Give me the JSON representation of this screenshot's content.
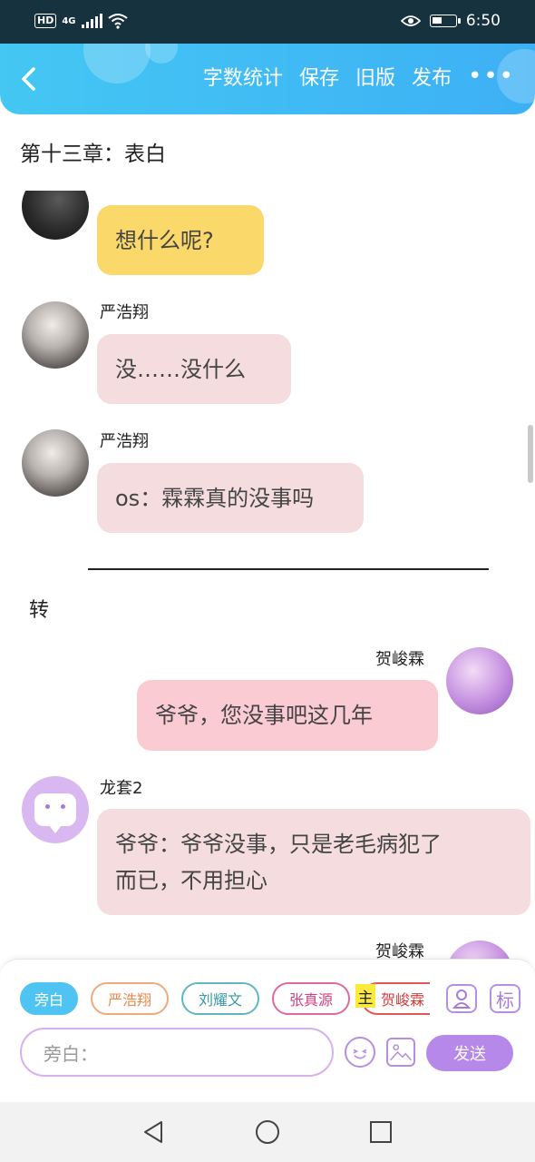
{
  "status_bar": {
    "hd": "HD",
    "network": "4G",
    "time": "6:50",
    "icons": [
      "signal-icon",
      "wifi-icon",
      "eye-icon",
      "battery-icon"
    ]
  },
  "header": {
    "back_icon": "back-arrow-icon",
    "actions": [
      {
        "label": "字数统计"
      },
      {
        "label": "保存"
      },
      {
        "label": "旧版"
      },
      {
        "label": "发布"
      }
    ],
    "more": "•••",
    "color": "#44c7f3"
  },
  "chapter_title": "第十三章：表白",
  "messages": {
    "m1": {
      "text": "想什么呢?"
    },
    "m2": {
      "name": "严浩翔",
      "text": "没……没什么"
    },
    "m3": {
      "name": "严浩翔",
      "text": "os：霖霖真的没事吗"
    },
    "transition": "转",
    "m4": {
      "name": "贺峻霖",
      "text": "爷爷，您没事吧这几年"
    },
    "m5": {
      "name": "龙套2",
      "text_line1": "爷爷：爷爷没事，只是老毛病犯了",
      "text_line2": "而已，不用担心"
    },
    "m6": {
      "name": "贺峻霖"
    }
  },
  "panel": {
    "chips": [
      {
        "label": "旁白"
      },
      {
        "label": "严浩翔"
      },
      {
        "label": "刘耀文"
      },
      {
        "label": "张真源"
      },
      {
        "label": "贺峻霖"
      }
    ],
    "main_tag": "主",
    "mark_label": "标",
    "input_placeholder": "旁白：",
    "send_label": "发送",
    "accent": "#b688ea"
  },
  "navbar": {
    "icons": [
      "nav-back-icon",
      "nav-home-icon",
      "nav-recents-icon"
    ]
  }
}
